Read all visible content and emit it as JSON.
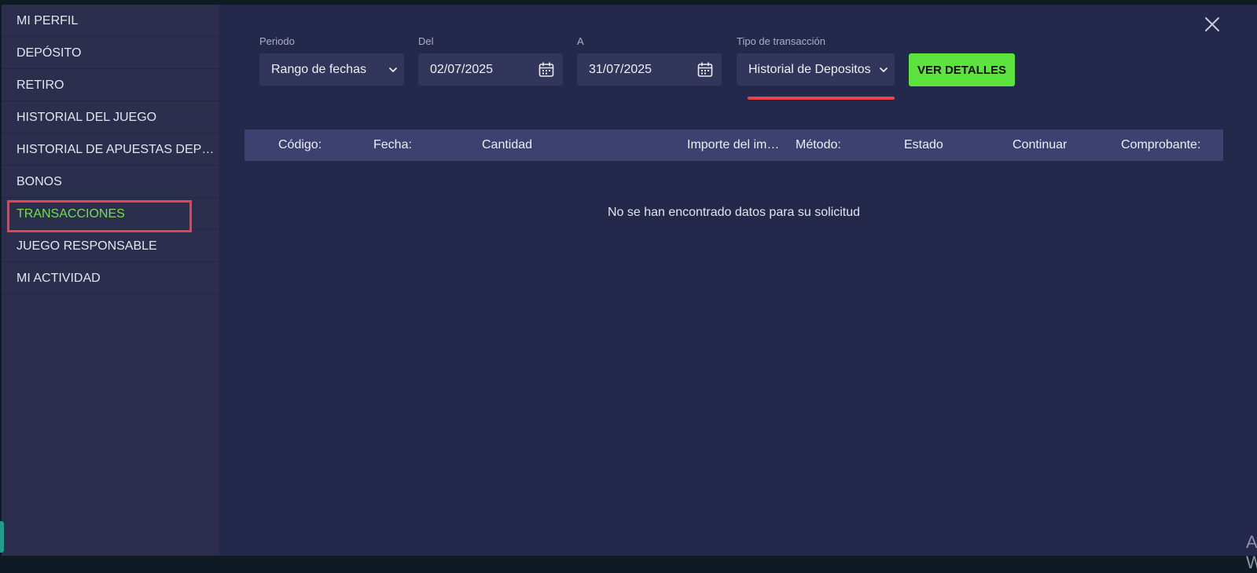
{
  "sidebar": {
    "items": [
      {
        "label": "MI PERFIL"
      },
      {
        "label": "DEPÓSITO"
      },
      {
        "label": "RETIRO"
      },
      {
        "label": "HISTORIAL DEL JUEGO"
      },
      {
        "label": "HISTORIAL DE APUESTAS DEPORTIVAS"
      },
      {
        "label": "BONOS"
      },
      {
        "label": "TRANSACCIONES"
      },
      {
        "label": "JUEGO RESPONSABLE"
      },
      {
        "label": "MI ACTIVIDAD"
      }
    ],
    "active_index": 6
  },
  "filters": {
    "period": {
      "label": "Periodo",
      "value": "Rango de fechas"
    },
    "from": {
      "label": "Del",
      "value": "02/07/2025"
    },
    "to": {
      "label": "A",
      "value": "31/07/2025"
    },
    "type": {
      "label": "Tipo de transacción",
      "value": "Historial de Depositos"
    },
    "submit_label": "VER DETALLES"
  },
  "table": {
    "columns": [
      "Código:",
      "Fecha:",
      "Cantidad",
      "Importe del impuesto",
      "Método:",
      "Estado",
      "Continuar",
      "Comprobante:"
    ],
    "empty_message": "No se han encontrado datos para su solicitud"
  },
  "watermark": "Activar Windows",
  "colors": {
    "accent_green": "#5ce33d",
    "active_text": "#6fe24a",
    "highlight_red": "#e8434a",
    "sidebar_bg": "#2b2f4d",
    "main_bg": "#24284a"
  },
  "icons": {
    "close": "close-icon",
    "dropdown": "chevron-down-icon",
    "date": "calendar-icon"
  }
}
